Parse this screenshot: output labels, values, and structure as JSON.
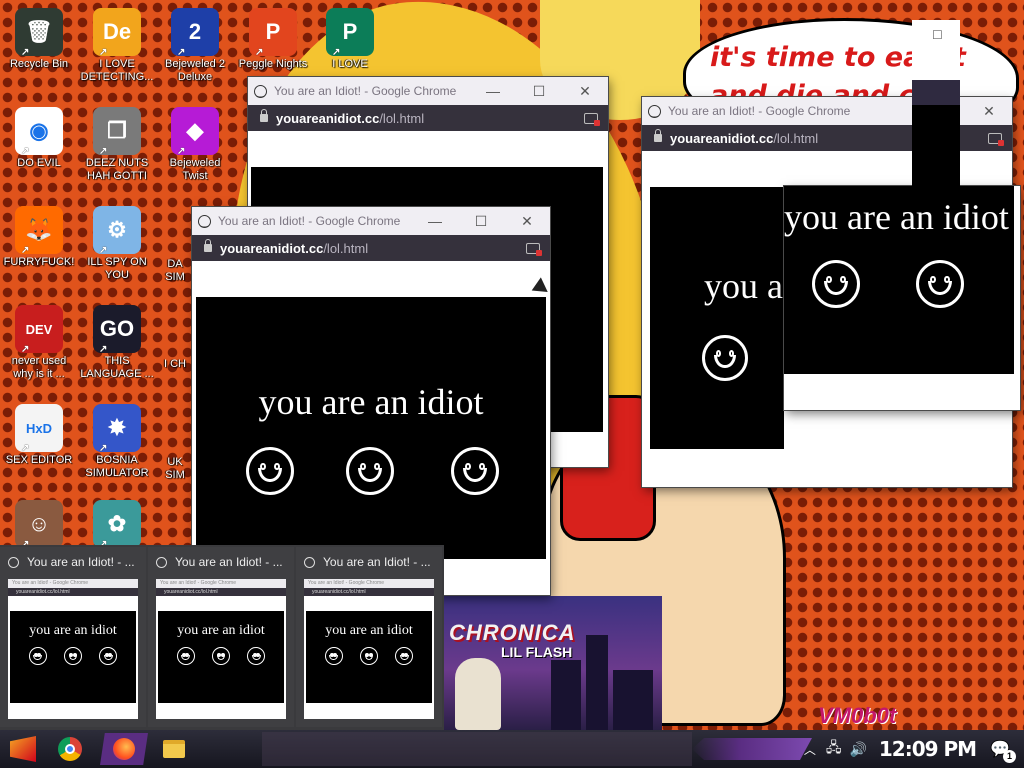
{
  "wallpaper": {
    "speech_line1": "it's time to eat it",
    "speech_line2": "and die and ch",
    "album_title": "CHRONICA",
    "album_sub": "LIL FLASH",
    "signature": "VM0b0t"
  },
  "desktop_icons": [
    {
      "label": "Recycle Bin",
      "icon": "recycle-bin-icon",
      "color": "#2f3b33",
      "glyph": "🗑"
    },
    {
      "label": "I LOVE DETECTING...",
      "icon": "de-app-icon",
      "color": "#f2a51c",
      "glyph": "De"
    },
    {
      "label": "Bejeweled 2 Deluxe",
      "icon": "bejeweled-2-icon",
      "color": "#1e3fa8",
      "glyph": "2"
    },
    {
      "label": "Peggle Nights",
      "icon": "peggle-icon",
      "color": "#e2451e",
      "glyph": "P"
    },
    {
      "label": "I LOVE",
      "icon": "publisher-icon",
      "color": "#0c7d58",
      "glyph": "P"
    },
    {
      "label": "DO EVIL",
      "icon": "chrome-icon",
      "color": "#ffffff",
      "glyph": "◉"
    },
    {
      "label": "DEEZ NUTS HAH GOTTI",
      "icon": "window-stack-icon",
      "color": "#7a7a7a",
      "glyph": "❐"
    },
    {
      "label": "Bejeweled Twist",
      "icon": "bejeweled-twist-icon",
      "color": "#b61bd6",
      "glyph": "◆"
    },
    {
      "label": "FURRYFUCK!",
      "icon": "firefox-icon",
      "color": "#ff6a00",
      "glyph": "🦊"
    },
    {
      "label": "ILL SPY ON YOU",
      "icon": "network-icon",
      "color": "#7fb5e6",
      "glyph": "⚙"
    },
    {
      "label": "never used why is it ...",
      "icon": "dev-cpp-icon",
      "color": "#c81e1e",
      "glyph": "DEV"
    },
    {
      "label": "THIS LANGUAGE ...",
      "icon": "goland-icon",
      "color": "#1b1b2b",
      "glyph": "GO"
    },
    {
      "label": "SEX EDITOR",
      "icon": "hxd-icon",
      "color": "#f4f4f4",
      "glyph": "HxD"
    },
    {
      "label": "BOSNIA SIMULATOR",
      "icon": "mine-icon",
      "color": "#3456c9",
      "glyph": "✸"
    },
    {
      "label": "",
      "icon": "portrait-icon",
      "color": "#8a5a40",
      "glyph": "☺"
    },
    {
      "label": "",
      "icon": "santa-icon",
      "color": "#3b9a9a",
      "glyph": "✿"
    }
  ],
  "partial_icons": [
    "DA SIM",
    "I CH",
    "UK SIM"
  ],
  "window_title": "You are an Idiot! - Google Chrome",
  "url_domain": "youareanidiot.cc",
  "url_path": "/lol.html",
  "page_text": "you are an idiot",
  "partial_text": "you a",
  "thumb_title": "You are an Idiot! - ...",
  "thumb_tiny_title": "You are an Idiot! - Google Chrome",
  "taskbar": {
    "clock": "12:09 PM",
    "notification_count": "1",
    "accent": "#5a2d82"
  }
}
